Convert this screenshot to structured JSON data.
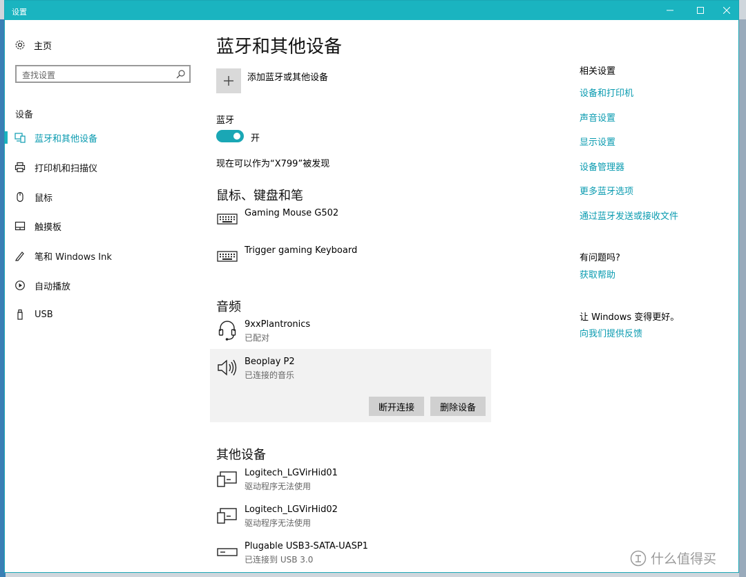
{
  "window": {
    "title": "设置"
  },
  "sidebar": {
    "home_label": "主页",
    "search_placeholder": "查找设置",
    "section_title": "设备",
    "items": [
      {
        "label": "蓝牙和其他设备",
        "icon": "bluetooth-devices-icon",
        "active": true
      },
      {
        "label": "打印机和扫描仪",
        "icon": "printer-icon"
      },
      {
        "label": "鼠标",
        "icon": "mouse-icon"
      },
      {
        "label": "触摸板",
        "icon": "touchpad-icon"
      },
      {
        "label": "笔和 Windows Ink",
        "icon": "pen-icon"
      },
      {
        "label": "自动播放",
        "icon": "autoplay-icon"
      },
      {
        "label": "USB",
        "icon": "usb-icon"
      }
    ]
  },
  "main": {
    "title": "蓝牙和其他设备",
    "add_device_label": "添加蓝牙或其他设备",
    "bluetooth_label": "蓝牙",
    "toggle_state": "开",
    "discoverable_text": "现在可以作为“X799”被发现",
    "mouse_section": {
      "title": "鼠标、键盘和笔",
      "devices": [
        {
          "name": "Gaming Mouse G502",
          "status": "",
          "icon": "keyboard-icon"
        },
        {
          "name": "Trigger gaming Keyboard",
          "status": "",
          "icon": "keyboard-icon"
        }
      ]
    },
    "audio_section": {
      "title": "音频",
      "devices": [
        {
          "name": "9xxPlantronics",
          "status": "已配对",
          "icon": "headset-icon"
        },
        {
          "name": "Beoplay P2",
          "status": "已连接的音乐",
          "icon": "speaker-icon"
        }
      ],
      "disconnect_label": "断开连接",
      "remove_label": "删除设备"
    },
    "other_section": {
      "title": "其他设备",
      "devices": [
        {
          "name": "Logitech_LGVirHid01",
          "status": "驱动程序无法使用",
          "icon": "generic-device-icon"
        },
        {
          "name": "Logitech_LGVirHid02",
          "status": "驱动程序无法使用",
          "icon": "generic-device-icon"
        },
        {
          "name": "Plugable USB3-SATA-UASP1",
          "status": "已连接到 USB 3.0",
          "icon": "drive-icon"
        }
      ]
    }
  },
  "related": {
    "title": "相关设置",
    "links": [
      "设备和打印机",
      "声音设置",
      "显示设置",
      "设备管理器",
      "更多蓝牙选项",
      "通过蓝牙发送或接收文件"
    ],
    "question_title": "有问题吗?",
    "help_link": "获取帮助",
    "improve_title": "让 Windows 变得更好。",
    "feedback_link": "向我们提供反馈"
  },
  "watermark": {
    "text": "什么值得买"
  },
  "colors": {
    "accent": "#1ab4c0",
    "link": "#0a9bb0"
  }
}
